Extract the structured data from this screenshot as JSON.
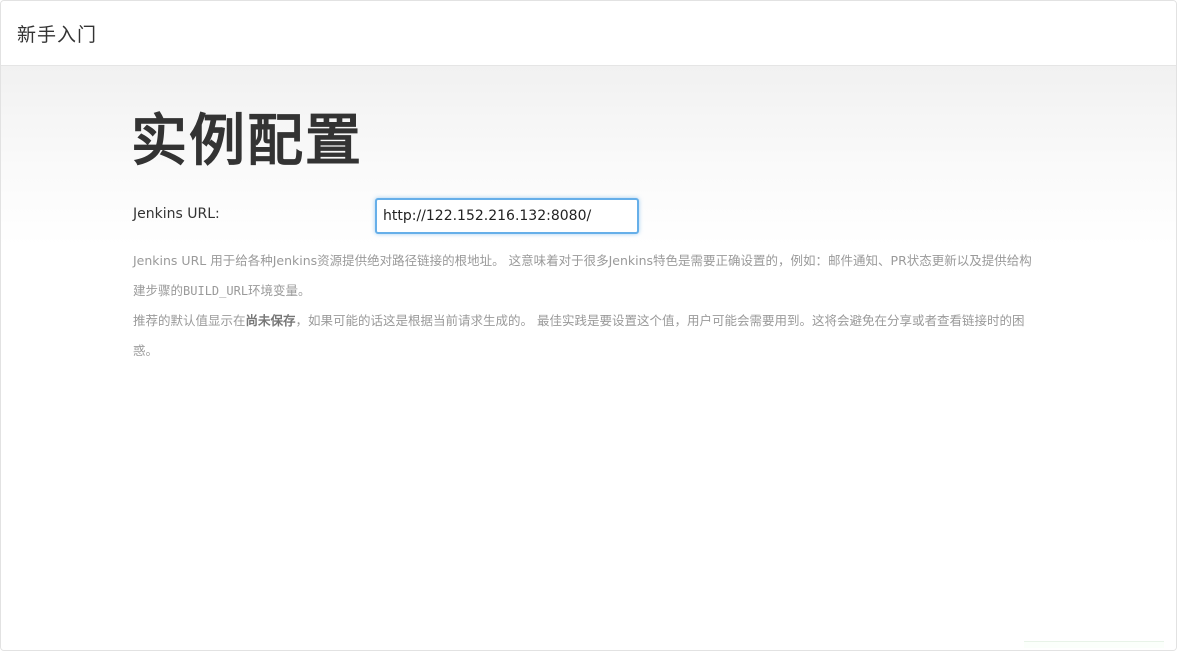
{
  "header": {
    "title": "新手入门"
  },
  "main": {
    "page_title": "实例配置",
    "url_field": {
      "label": "Jenkins URL:",
      "value": "http://122.152.216.132:8080/"
    },
    "help": {
      "p1_text1": "Jenkins URL 用于给各种Jenkins资源提供绝对路径链接的根地址。 这意味着对于很多Jenkins特色是需要正确设置的，例如：邮件通知、PR状态更新以及提供给构建步骤的",
      "p1_code": "BUILD_URL",
      "p1_text2": "环境变量。",
      "p2_text1": "推荐的默认值显示在",
      "p2_strong": "尚未保存",
      "p2_text2": "，如果可能的话这是根据当前请求生成的。 最佳实践是要设置这个值，用户可能会需要用到。这将会避免在分享或者查看链接时的困惑。"
    }
  }
}
